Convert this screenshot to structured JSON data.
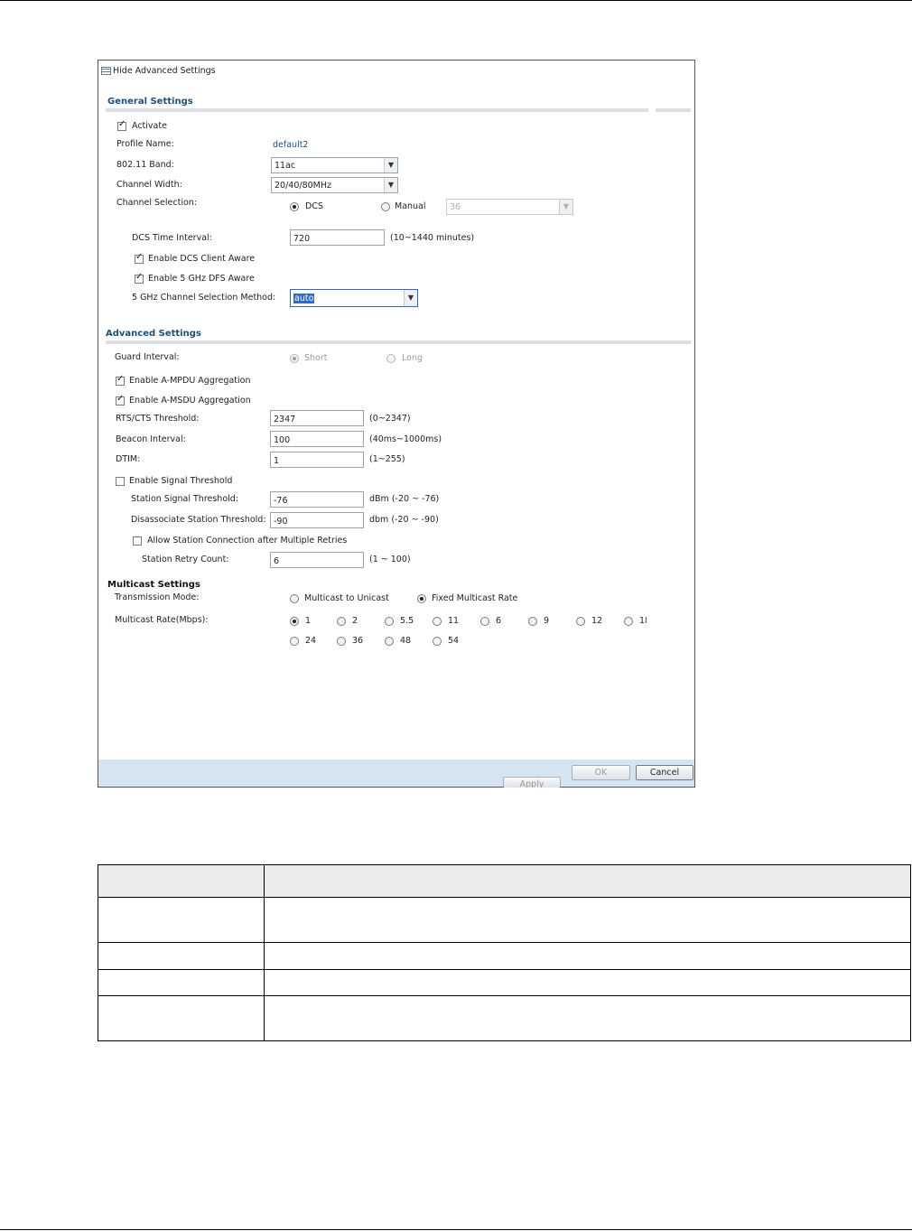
{
  "dialog": {
    "hide_advanced": "Hide Advanced Settings",
    "general": {
      "title": "General Settings",
      "activate_label": "Activate",
      "activate_checked": true,
      "profile_name_label": "Profile Name:",
      "profile_name_value": "default2",
      "band_label": "802.11 Band:",
      "band_value": "11ac",
      "channel_width_label": "Channel Width:",
      "channel_width_value": "20/40/80MHz",
      "channel_selection_label": "Channel Selection:",
      "channel_dcs_label": "DCS",
      "channel_manual_label": "Manual",
      "channel_selected": "DCS",
      "manual_channel_value": "36",
      "dcs_interval_label": "DCS Time Interval:",
      "dcs_interval_value": "720",
      "dcs_interval_range": "(10~1440 minutes)",
      "dcs_client_aware_label": "Enable DCS Client Aware",
      "dcs_client_aware_checked": true,
      "dfs_aware_label": "Enable 5 GHz DFS Aware",
      "dfs_aware_checked": true,
      "selection_method_label": "5 GHz Channel Selection Method:",
      "selection_method_value": "auto"
    },
    "advanced": {
      "title": "Advanced Settings",
      "guard_interval_label": "Guard Interval:",
      "guard_short_label": "Short",
      "guard_long_label": "Long",
      "guard_selected": "Short",
      "ampdu_label": "Enable A-MPDU Aggregation",
      "ampdu_checked": true,
      "amsdu_label": "Enable A-MSDU Aggregation",
      "amsdu_checked": true,
      "rts_label": "RTS/CTS Threshold:",
      "rts_value": "2347",
      "rts_range": "(0~2347)",
      "beacon_label": "Beacon Interval:",
      "beacon_value": "100",
      "beacon_range": "(40ms~1000ms)",
      "dtim_label": "DTIM:",
      "dtim_value": "1",
      "dtim_range": "(1~255)",
      "signal_threshold_label": "Enable Signal Threshold",
      "signal_threshold_checked": false,
      "station_signal_label": "Station Signal Threshold:",
      "station_signal_value": "-76",
      "station_signal_range": "dBm (-20 ~ -76)",
      "disassociate_label": "Disassociate Station Threshold:",
      "disassociate_value": "-90",
      "disassociate_range": "dbm (-20 ~ -90)",
      "allow_retries_label": "Allow Station Connection after Multiple Retries",
      "allow_retries_checked": false,
      "retry_count_label": "Station Retry Count:",
      "retry_count_value": "6",
      "retry_count_range": "(1 ~ 100)"
    },
    "multicast": {
      "title": "Multicast Settings",
      "transmission_label": "Transmission Mode:",
      "mode_unicast_label": "Multicast to Unicast",
      "mode_fixed_label": "Fixed Multicast Rate",
      "mode_selected": "Fixed Multicast Rate",
      "rate_label": "Multicast Rate(Mbps):",
      "rates": [
        "1",
        "2",
        "5.5",
        "11",
        "6",
        "9",
        "12",
        "18",
        "24",
        "36",
        "48",
        "54"
      ],
      "rate_selected": "1"
    },
    "buttons": {
      "apply_label": "Apply",
      "ok_label": "OK",
      "cancel_label": "Cancel"
    }
  },
  "colors": {
    "section_header": "#1f4e79",
    "footer_bar": "#d6e3f1",
    "selection_highlight": "#3169c6"
  }
}
